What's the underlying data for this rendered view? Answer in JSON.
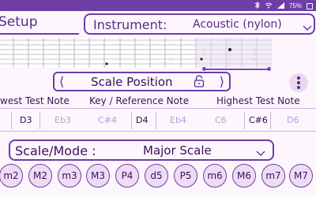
{
  "status_bar": {
    "battery": "75%",
    "icons": [
      "bluetooth-icon",
      "wifi-icon",
      "signal-icon",
      "battery-icon"
    ]
  },
  "header": {
    "setup_title": "Setup",
    "instrument_label": "Instrument:",
    "instrument_value": "Acoustic (nylon)"
  },
  "scale_position": {
    "label": "Scale Position",
    "prev_glyph": "⟨",
    "next_glyph": "⟩"
  },
  "labels": {
    "lowest": "west Test Note",
    "key": "Key / Reference Note",
    "highest": "Highest Test Note"
  },
  "notes": [
    {
      "text": "D3",
      "active": true
    },
    {
      "text": "Eb3",
      "active": false
    },
    {
      "text": "C#4",
      "active": false
    },
    {
      "text": "D4",
      "active": true
    },
    {
      "text": "Eb4",
      "active": false
    },
    {
      "text": "C6",
      "active": false
    },
    {
      "text": "C#6",
      "active": true
    },
    {
      "text": "D6",
      "active": false
    }
  ],
  "scale_mode": {
    "label": "Scale/Mode :",
    "value": "Major Scale"
  },
  "intervals": [
    "m2",
    "M2",
    "m3",
    "M3",
    "P4",
    "d5",
    "P5",
    "m6",
    "M6",
    "m7",
    "M7"
  ],
  "colors": {
    "accent": "#6c3ea6",
    "background": "#fdf6fd",
    "text": "#3b1060",
    "dim_text": "#b69ed0"
  }
}
